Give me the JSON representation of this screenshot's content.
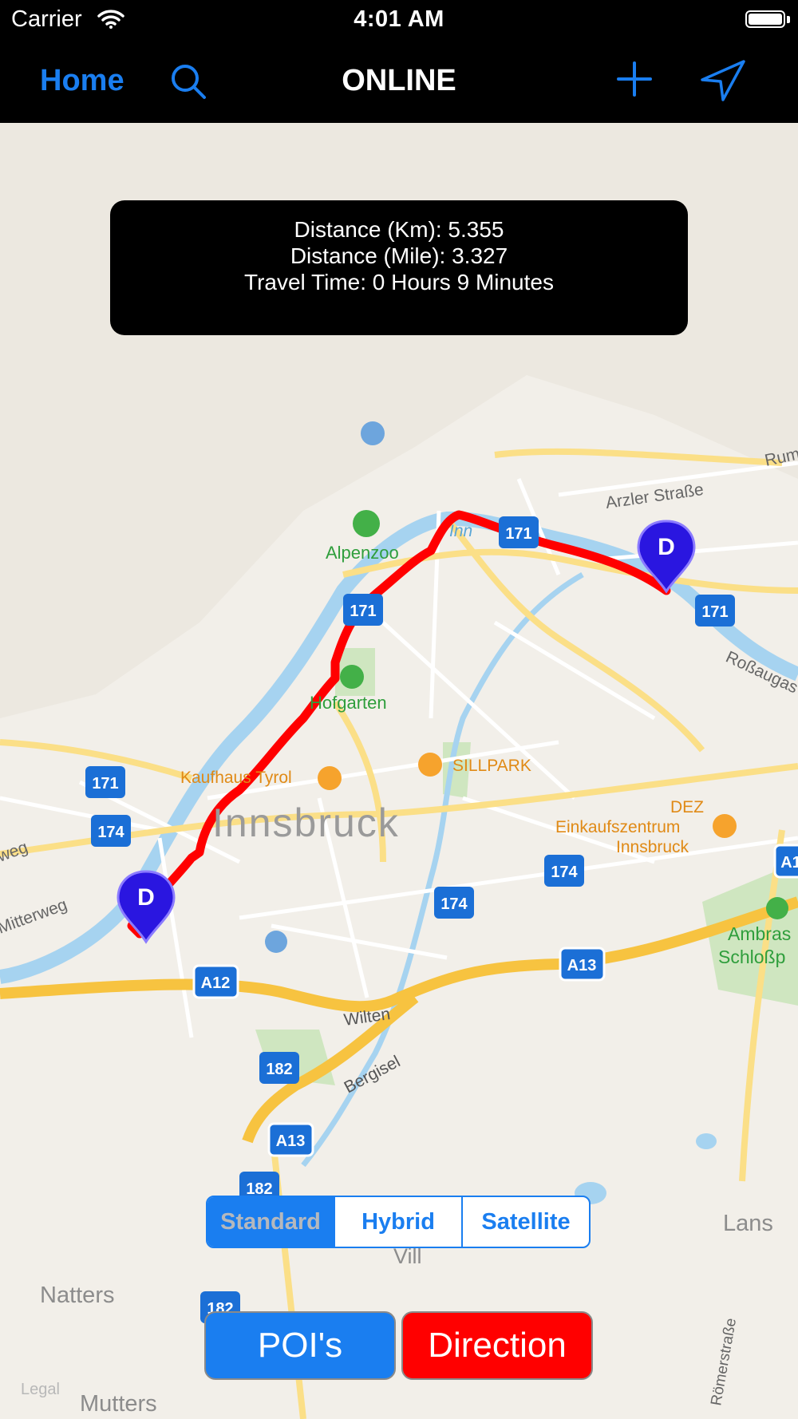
{
  "status_bar": {
    "carrier": "Carrier",
    "time": "4:01 AM"
  },
  "nav": {
    "home_label": "Home",
    "title": "ONLINE",
    "search_icon": "search-icon",
    "add_icon": "plus-icon",
    "location_icon": "location-arrow-icon"
  },
  "info_panel": {
    "distance_km": "Distance (Km): 5.355",
    "distance_mile": "Distance (Mile): 3.327",
    "travel_time": "Travel Time: 0 Hours 9 Minutes"
  },
  "map": {
    "pin_label": "D",
    "city_label": "Innsbruck",
    "labels": {
      "alpenzoo": "Alpenzoo",
      "hofgarten": "Hofgarten",
      "kaufhaus": "Kaufhaus Tyrol",
      "sillpark": "SILLPARK",
      "dez": "DEZ",
      "einkauf1": "Einkaufszentrum",
      "einkauf2": "Innsbruck",
      "inn": "Inn",
      "arzler": "Arzler Straße",
      "rum": "Rum",
      "rossau": "Roßaugas",
      "ambras1": "Ambras",
      "ambras2": "Schloßp",
      "wilten": "Wilten",
      "bergisel": "Bergisel",
      "vill": "Vill",
      "lans": "Lans",
      "natters": "Natters",
      "mutters": "Mutters",
      "mitterweg": "Mitterweg",
      "weg": "weg",
      "roemer": "Römerstraße"
    },
    "shields": {
      "s171a": "171",
      "s171b": "171",
      "s171c": "171",
      "s171d": "171",
      "s174a": "174",
      "s174b": "174",
      "s174c": "174",
      "a12": "A12",
      "a13a": "A13",
      "a13b": "A13",
      "a1": "A1",
      "s182a": "182",
      "s182b": "182",
      "s182c": "182"
    },
    "route_color": "#ff0000",
    "pin_color": "#2a16e0"
  },
  "map_type": {
    "options": [
      "Standard",
      "Hybrid",
      "Satellite"
    ],
    "selected": "Standard"
  },
  "buttons": {
    "pois_label": "POI's",
    "direction_label": "Direction"
  },
  "legal": "Legal",
  "colors": {
    "accent": "#1a7ef0",
    "direction": "#ff0000",
    "nav_background": "#000000"
  }
}
